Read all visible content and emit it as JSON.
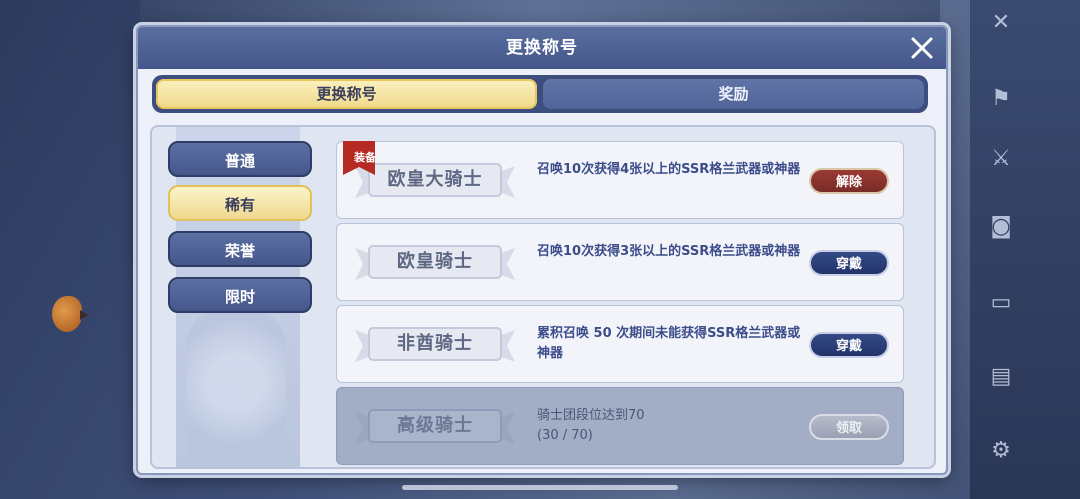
{
  "dialog": {
    "title": "更换称号",
    "tabs": [
      {
        "label": "更换称号",
        "active": true
      },
      {
        "label": "奖励",
        "active": false
      }
    ]
  },
  "categories": [
    {
      "label": "普通",
      "active": false
    },
    {
      "label": "稀有",
      "active": true
    },
    {
      "label": "荣誉",
      "active": false
    },
    {
      "label": "限时",
      "active": false
    }
  ],
  "titles": [
    {
      "name": "欧皇大骑士",
      "description": "召唤10次获得4张以上的SSR格兰武器或神器",
      "button": "解除",
      "equipped_tag": "装备"
    },
    {
      "name": "欧皇骑士",
      "description": "召唤10次获得3张以上的SSR格兰武器或神器",
      "button": "穿戴"
    },
    {
      "name": "非酋骑士",
      "description": "累积召唤 50 次期间未能获得SSR格兰武器或神器",
      "button": "穿戴"
    },
    {
      "name": "高级骑士",
      "description": "骑士团段位达到70",
      "progress": "(30 / 70)",
      "button": "领取"
    }
  ],
  "colors": {
    "accent_gold": "#f0d987",
    "nav_blue": "#44568a",
    "remove_red": "#7a2b26",
    "wear_navy": "#22346a"
  }
}
